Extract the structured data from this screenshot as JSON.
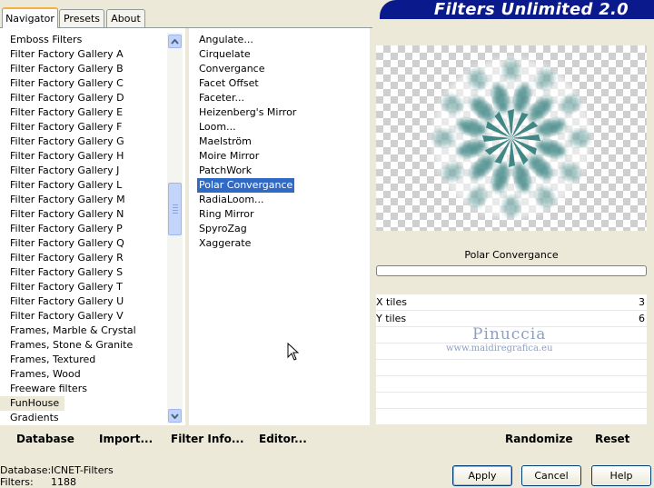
{
  "tabs": [
    {
      "label": "Navigator",
      "active": true
    },
    {
      "label": "Presets",
      "active": false
    },
    {
      "label": "About",
      "active": false
    }
  ],
  "app_title": "Filters Unlimited 2.0",
  "categories": [
    "Emboss Filters",
    "Filter Factory Gallery A",
    "Filter Factory Gallery B",
    "Filter Factory Gallery C",
    "Filter Factory Gallery D",
    "Filter Factory Gallery E",
    "Filter Factory Gallery F",
    "Filter Factory Gallery G",
    "Filter Factory Gallery H",
    "Filter Factory Gallery J",
    "Filter Factory Gallery L",
    "Filter Factory Gallery M",
    "Filter Factory Gallery N",
    "Filter Factory Gallery P",
    "Filter Factory Gallery Q",
    "Filter Factory Gallery R",
    "Filter Factory Gallery S",
    "Filter Factory Gallery T",
    "Filter Factory Gallery U",
    "Filter Factory Gallery V",
    "Frames, Marble & Crystal",
    "Frames, Stone & Granite",
    "Frames, Textured",
    "Frames, Wood",
    "Freeware filters",
    "FunHouse",
    "Gradients"
  ],
  "selected_category": "FunHouse",
  "filters": [
    "Angulate...",
    "Cirquelate",
    "Convergance",
    "Facet Offset",
    "Faceter...",
    "Heizenberg's Mirror",
    "Loom...",
    "Maelström",
    "Moire Mirror",
    "PatchWork",
    "Polar Convergance",
    "RadiaLoom...",
    "Ring Mirror",
    "SpyroZag",
    "Xaggerate"
  ],
  "selected_filter": "Polar Convergance",
  "preview": {
    "filter_name": "Polar Convergance",
    "accent_color": "#2e7b7a"
  },
  "params": [
    {
      "name": "X tiles",
      "value": "3"
    },
    {
      "name": "Y tiles",
      "value": "6"
    }
  ],
  "watermark": {
    "name": "Pinuccia",
    "site": "www.maidiregrafica.eu"
  },
  "actions": {
    "database": "Database",
    "import": "Import...",
    "filter_info": "Filter Info...",
    "editor": "Editor...",
    "randomize": "Randomize",
    "reset": "Reset"
  },
  "info": {
    "database_label": "Database:",
    "database_value": "ICNET-Filters",
    "filters_label": "Filters:",
    "filters_value": "1188"
  },
  "buttons": {
    "apply": "Apply",
    "cancel": "Cancel",
    "help": "Help"
  }
}
